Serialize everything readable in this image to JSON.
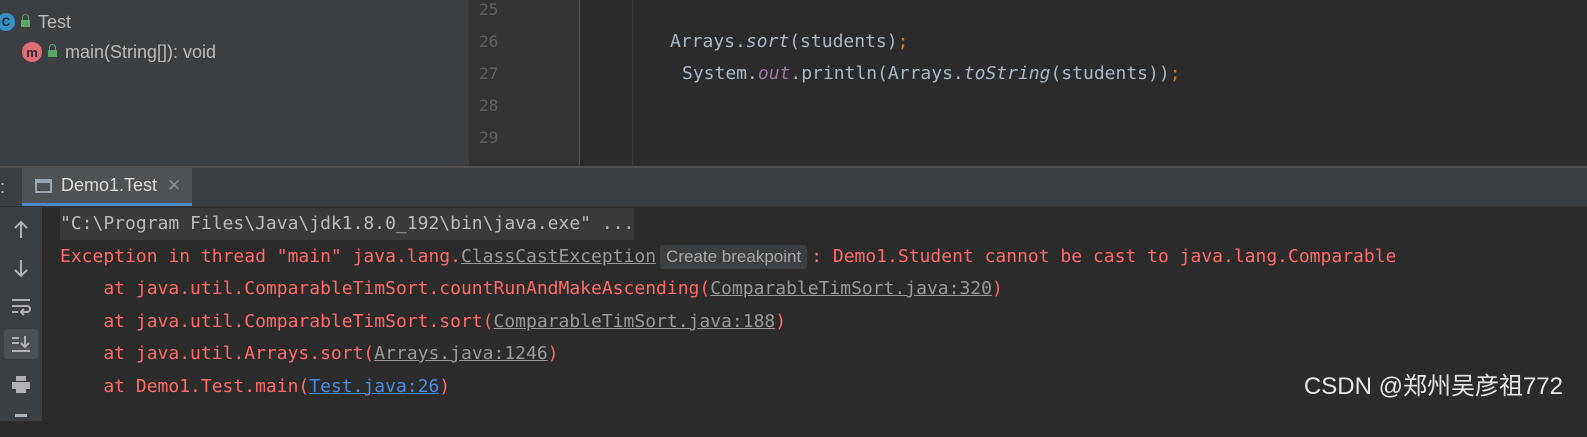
{
  "structure": {
    "items": [
      {
        "name": "Test",
        "icon": "class-icon",
        "icon_letter": "C"
      },
      {
        "name": "main(String[]): void",
        "icon": "method-icon",
        "icon_letter": "m"
      }
    ]
  },
  "editor": {
    "line_numbers": [
      "25",
      "26",
      "27",
      "28",
      "29"
    ],
    "line26": {
      "a": "Arrays.",
      "b": "sort",
      "c": "(students)",
      "d": ";"
    },
    "line27": {
      "a": "System.",
      "b": "out",
      "c": ".println(Arrays.",
      "d": "toString",
      "e": "(students))",
      "f": ";"
    }
  },
  "run_panel": {
    "colon": ":",
    "tab_label": "Demo1.Test",
    "close_glyph": "✕",
    "console": {
      "cmd": "\"C:\\Program Files\\Java\\jdk1.8.0_192\\bin\\java.exe\" ...",
      "exception_prefix": "Exception in thread \"main\" java.lang.",
      "exception_class": "ClassCastException",
      "breakpoint_hint": "Create breakpoint",
      "exception_message": ": Demo1.Student cannot be cast to java.lang.Comparable",
      "stack": [
        {
          "prefix": "    at java.util.ComparableTimSort.countRunAndMakeAscending(",
          "link": "ComparableTimSort.java:320",
          "suffix": ")"
        },
        {
          "prefix": "    at java.util.ComparableTimSort.sort(",
          "link": "ComparableTimSort.java:188",
          "suffix": ")"
        },
        {
          "prefix": "    at java.util.Arrays.sort(",
          "link": "Arrays.java:1246",
          "suffix": ")"
        },
        {
          "prefix": "    at Demo1.Test.main(",
          "link": "Test.java:26",
          "suffix": ")"
        }
      ]
    }
  },
  "watermark": "CSDN @郑州吴彦祖772",
  "colors": {
    "error": "#ff6b68",
    "link_blue": "#4a8de3",
    "accent": "#4a88c7"
  }
}
